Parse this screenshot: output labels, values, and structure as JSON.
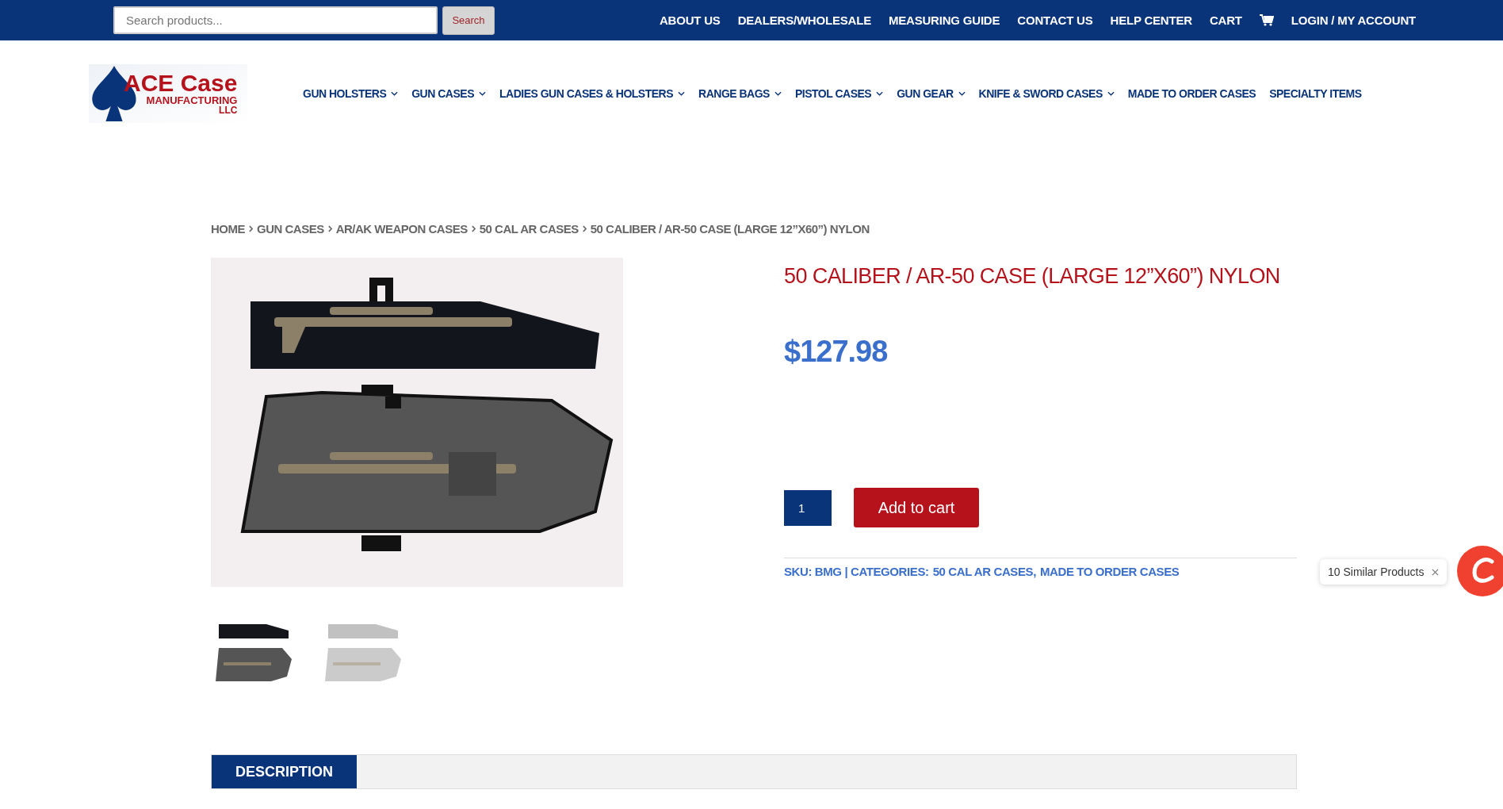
{
  "top_bar": {
    "search": {
      "placeholder": "Search products...",
      "button": "Search"
    },
    "links": [
      {
        "label": "ABOUT US",
        "kind": "text"
      },
      {
        "label": "DEALERS/WHOLESALE",
        "kind": "text"
      },
      {
        "label": "MEASURING GUIDE",
        "kind": "text"
      },
      {
        "label": "CONTACT US",
        "kind": "text"
      },
      {
        "label": "HELP CENTER",
        "kind": "text"
      },
      {
        "label": "CART",
        "kind": "text"
      },
      {
        "kind": "cart"
      },
      {
        "label": "LOGIN / MY ACCOUNT",
        "kind": "text"
      }
    ]
  },
  "logo": {
    "line1": "ACE Case",
    "line2": "MANUFACTURING",
    "line3": "LLC"
  },
  "nav": [
    {
      "label": "GUN HOLSTERS",
      "has_dropdown": true
    },
    {
      "label": "GUN CASES",
      "has_dropdown": true
    },
    {
      "label": "LADIES GUN CASES & HOLSTERS",
      "has_dropdown": true
    },
    {
      "label": "RANGE BAGS",
      "has_dropdown": true
    },
    {
      "label": "PISTOL CASES",
      "has_dropdown": true
    },
    {
      "label": "GUN GEAR",
      "has_dropdown": true
    },
    {
      "label": "KNIFE & SWORD CASES",
      "has_dropdown": true
    },
    {
      "label": "MADE TO ORDER CASES",
      "has_dropdown": false
    },
    {
      "label": "SPECIALTY ITEMS",
      "has_dropdown": false
    }
  ],
  "breadcrumb": [
    "HOME",
    "GUN CASES",
    "AR/AK WEAPON CASES",
    "50 CAL AR CASES",
    "50 CALIBER / AR-50 CASE (LARGE 12”X60”) NYLON"
  ],
  "thumbnails": [
    {
      "selected": true
    },
    {
      "selected": false
    }
  ],
  "product": {
    "title": "50 CALIBER / AR-50 CASE (LARGE 12”X60”) NYLON",
    "price": "$127.98",
    "quantity": "1",
    "add_button": "Add to cart",
    "meta_prefix": "SKU: BMG | CATEGORIES:",
    "categories": [
      "50 CAL AR CASES,",
      "MADE TO ORDER CASES"
    ]
  },
  "similar_widget": {
    "label": "10 Similar Products"
  },
  "tabs": [
    {
      "label": "DESCRIPTION",
      "selected": true
    }
  ]
}
